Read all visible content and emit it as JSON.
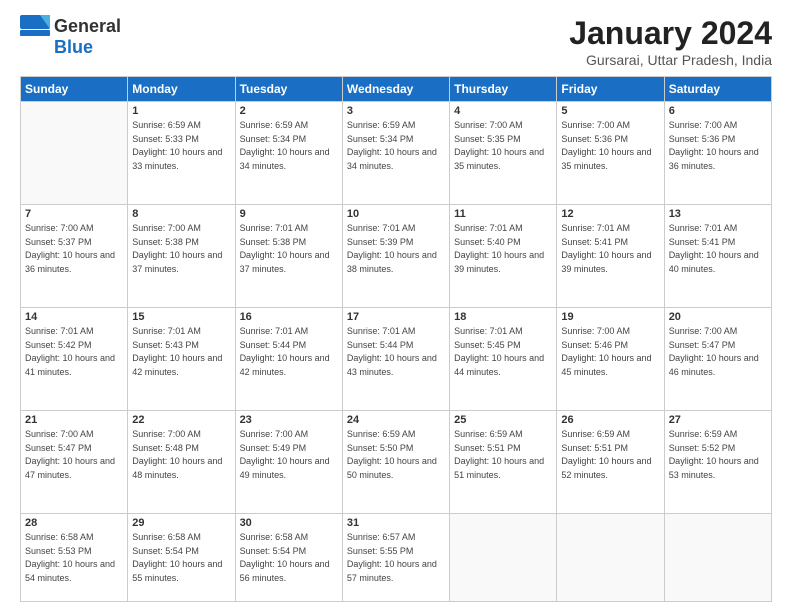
{
  "header": {
    "logo_general": "General",
    "logo_blue": "Blue",
    "month": "January 2024",
    "location": "Gursarai, Uttar Pradesh, India"
  },
  "days_of_week": [
    "Sunday",
    "Monday",
    "Tuesday",
    "Wednesday",
    "Thursday",
    "Friday",
    "Saturday"
  ],
  "weeks": [
    [
      {
        "day": "",
        "empty": true
      },
      {
        "day": "1",
        "sunrise": "6:59 AM",
        "sunset": "5:33 PM",
        "daylight": "10 hours and 33 minutes."
      },
      {
        "day": "2",
        "sunrise": "6:59 AM",
        "sunset": "5:34 PM",
        "daylight": "10 hours and 34 minutes."
      },
      {
        "day": "3",
        "sunrise": "6:59 AM",
        "sunset": "5:34 PM",
        "daylight": "10 hours and 34 minutes."
      },
      {
        "day": "4",
        "sunrise": "7:00 AM",
        "sunset": "5:35 PM",
        "daylight": "10 hours and 35 minutes."
      },
      {
        "day": "5",
        "sunrise": "7:00 AM",
        "sunset": "5:36 PM",
        "daylight": "10 hours and 35 minutes."
      },
      {
        "day": "6",
        "sunrise": "7:00 AM",
        "sunset": "5:36 PM",
        "daylight": "10 hours and 36 minutes."
      }
    ],
    [
      {
        "day": "7",
        "sunrise": "7:00 AM",
        "sunset": "5:37 PM",
        "daylight": "10 hours and 36 minutes."
      },
      {
        "day": "8",
        "sunrise": "7:00 AM",
        "sunset": "5:38 PM",
        "daylight": "10 hours and 37 minutes."
      },
      {
        "day": "9",
        "sunrise": "7:01 AM",
        "sunset": "5:38 PM",
        "daylight": "10 hours and 37 minutes."
      },
      {
        "day": "10",
        "sunrise": "7:01 AM",
        "sunset": "5:39 PM",
        "daylight": "10 hours and 38 minutes."
      },
      {
        "day": "11",
        "sunrise": "7:01 AM",
        "sunset": "5:40 PM",
        "daylight": "10 hours and 39 minutes."
      },
      {
        "day": "12",
        "sunrise": "7:01 AM",
        "sunset": "5:41 PM",
        "daylight": "10 hours and 39 minutes."
      },
      {
        "day": "13",
        "sunrise": "7:01 AM",
        "sunset": "5:41 PM",
        "daylight": "10 hours and 40 minutes."
      }
    ],
    [
      {
        "day": "14",
        "sunrise": "7:01 AM",
        "sunset": "5:42 PM",
        "daylight": "10 hours and 41 minutes."
      },
      {
        "day": "15",
        "sunrise": "7:01 AM",
        "sunset": "5:43 PM",
        "daylight": "10 hours and 42 minutes."
      },
      {
        "day": "16",
        "sunrise": "7:01 AM",
        "sunset": "5:44 PM",
        "daylight": "10 hours and 42 minutes."
      },
      {
        "day": "17",
        "sunrise": "7:01 AM",
        "sunset": "5:44 PM",
        "daylight": "10 hours and 43 minutes."
      },
      {
        "day": "18",
        "sunrise": "7:01 AM",
        "sunset": "5:45 PM",
        "daylight": "10 hours and 44 minutes."
      },
      {
        "day": "19",
        "sunrise": "7:00 AM",
        "sunset": "5:46 PM",
        "daylight": "10 hours and 45 minutes."
      },
      {
        "day": "20",
        "sunrise": "7:00 AM",
        "sunset": "5:47 PM",
        "daylight": "10 hours and 46 minutes."
      }
    ],
    [
      {
        "day": "21",
        "sunrise": "7:00 AM",
        "sunset": "5:47 PM",
        "daylight": "10 hours and 47 minutes."
      },
      {
        "day": "22",
        "sunrise": "7:00 AM",
        "sunset": "5:48 PM",
        "daylight": "10 hours and 48 minutes."
      },
      {
        "day": "23",
        "sunrise": "7:00 AM",
        "sunset": "5:49 PM",
        "daylight": "10 hours and 49 minutes."
      },
      {
        "day": "24",
        "sunrise": "6:59 AM",
        "sunset": "5:50 PM",
        "daylight": "10 hours and 50 minutes."
      },
      {
        "day": "25",
        "sunrise": "6:59 AM",
        "sunset": "5:51 PM",
        "daylight": "10 hours and 51 minutes."
      },
      {
        "day": "26",
        "sunrise": "6:59 AM",
        "sunset": "5:51 PM",
        "daylight": "10 hours and 52 minutes."
      },
      {
        "day": "27",
        "sunrise": "6:59 AM",
        "sunset": "5:52 PM",
        "daylight": "10 hours and 53 minutes."
      }
    ],
    [
      {
        "day": "28",
        "sunrise": "6:58 AM",
        "sunset": "5:53 PM",
        "daylight": "10 hours and 54 minutes."
      },
      {
        "day": "29",
        "sunrise": "6:58 AM",
        "sunset": "5:54 PM",
        "daylight": "10 hours and 55 minutes."
      },
      {
        "day": "30",
        "sunrise": "6:58 AM",
        "sunset": "5:54 PM",
        "daylight": "10 hours and 56 minutes."
      },
      {
        "day": "31",
        "sunrise": "6:57 AM",
        "sunset": "5:55 PM",
        "daylight": "10 hours and 57 minutes."
      },
      {
        "day": "",
        "empty": true
      },
      {
        "day": "",
        "empty": true
      },
      {
        "day": "",
        "empty": true
      }
    ]
  ]
}
